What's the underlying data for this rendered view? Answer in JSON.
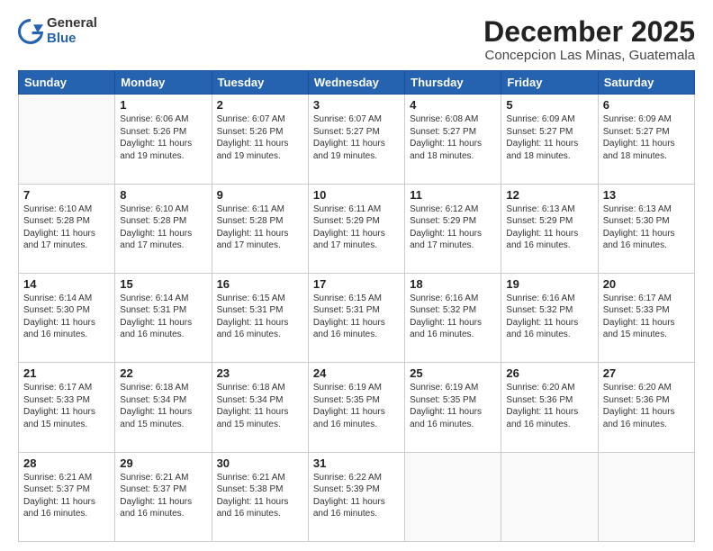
{
  "header": {
    "logo_line1": "General",
    "logo_line2": "Blue",
    "month": "December 2025",
    "location": "Concepcion Las Minas, Guatemala"
  },
  "weekdays": [
    "Sunday",
    "Monday",
    "Tuesday",
    "Wednesday",
    "Thursday",
    "Friday",
    "Saturday"
  ],
  "weeks": [
    [
      {
        "day": "",
        "info": ""
      },
      {
        "day": "1",
        "info": "Sunrise: 6:06 AM\nSunset: 5:26 PM\nDaylight: 11 hours\nand 19 minutes."
      },
      {
        "day": "2",
        "info": "Sunrise: 6:07 AM\nSunset: 5:26 PM\nDaylight: 11 hours\nand 19 minutes."
      },
      {
        "day": "3",
        "info": "Sunrise: 6:07 AM\nSunset: 5:27 PM\nDaylight: 11 hours\nand 19 minutes."
      },
      {
        "day": "4",
        "info": "Sunrise: 6:08 AM\nSunset: 5:27 PM\nDaylight: 11 hours\nand 18 minutes."
      },
      {
        "day": "5",
        "info": "Sunrise: 6:09 AM\nSunset: 5:27 PM\nDaylight: 11 hours\nand 18 minutes."
      },
      {
        "day": "6",
        "info": "Sunrise: 6:09 AM\nSunset: 5:27 PM\nDaylight: 11 hours\nand 18 minutes."
      }
    ],
    [
      {
        "day": "7",
        "info": "Sunrise: 6:10 AM\nSunset: 5:28 PM\nDaylight: 11 hours\nand 17 minutes."
      },
      {
        "day": "8",
        "info": "Sunrise: 6:10 AM\nSunset: 5:28 PM\nDaylight: 11 hours\nand 17 minutes."
      },
      {
        "day": "9",
        "info": "Sunrise: 6:11 AM\nSunset: 5:28 PM\nDaylight: 11 hours\nand 17 minutes."
      },
      {
        "day": "10",
        "info": "Sunrise: 6:11 AM\nSunset: 5:29 PM\nDaylight: 11 hours\nand 17 minutes."
      },
      {
        "day": "11",
        "info": "Sunrise: 6:12 AM\nSunset: 5:29 PM\nDaylight: 11 hours\nand 17 minutes."
      },
      {
        "day": "12",
        "info": "Sunrise: 6:13 AM\nSunset: 5:29 PM\nDaylight: 11 hours\nand 16 minutes."
      },
      {
        "day": "13",
        "info": "Sunrise: 6:13 AM\nSunset: 5:30 PM\nDaylight: 11 hours\nand 16 minutes."
      }
    ],
    [
      {
        "day": "14",
        "info": "Sunrise: 6:14 AM\nSunset: 5:30 PM\nDaylight: 11 hours\nand 16 minutes."
      },
      {
        "day": "15",
        "info": "Sunrise: 6:14 AM\nSunset: 5:31 PM\nDaylight: 11 hours\nand 16 minutes."
      },
      {
        "day": "16",
        "info": "Sunrise: 6:15 AM\nSunset: 5:31 PM\nDaylight: 11 hours\nand 16 minutes."
      },
      {
        "day": "17",
        "info": "Sunrise: 6:15 AM\nSunset: 5:31 PM\nDaylight: 11 hours\nand 16 minutes."
      },
      {
        "day": "18",
        "info": "Sunrise: 6:16 AM\nSunset: 5:32 PM\nDaylight: 11 hours\nand 16 minutes."
      },
      {
        "day": "19",
        "info": "Sunrise: 6:16 AM\nSunset: 5:32 PM\nDaylight: 11 hours\nand 16 minutes."
      },
      {
        "day": "20",
        "info": "Sunrise: 6:17 AM\nSunset: 5:33 PM\nDaylight: 11 hours\nand 15 minutes."
      }
    ],
    [
      {
        "day": "21",
        "info": "Sunrise: 6:17 AM\nSunset: 5:33 PM\nDaylight: 11 hours\nand 15 minutes."
      },
      {
        "day": "22",
        "info": "Sunrise: 6:18 AM\nSunset: 5:34 PM\nDaylight: 11 hours\nand 15 minutes."
      },
      {
        "day": "23",
        "info": "Sunrise: 6:18 AM\nSunset: 5:34 PM\nDaylight: 11 hours\nand 15 minutes."
      },
      {
        "day": "24",
        "info": "Sunrise: 6:19 AM\nSunset: 5:35 PM\nDaylight: 11 hours\nand 16 minutes."
      },
      {
        "day": "25",
        "info": "Sunrise: 6:19 AM\nSunset: 5:35 PM\nDaylight: 11 hours\nand 16 minutes."
      },
      {
        "day": "26",
        "info": "Sunrise: 6:20 AM\nSunset: 5:36 PM\nDaylight: 11 hours\nand 16 minutes."
      },
      {
        "day": "27",
        "info": "Sunrise: 6:20 AM\nSunset: 5:36 PM\nDaylight: 11 hours\nand 16 minutes."
      }
    ],
    [
      {
        "day": "28",
        "info": "Sunrise: 6:21 AM\nSunset: 5:37 PM\nDaylight: 11 hours\nand 16 minutes."
      },
      {
        "day": "29",
        "info": "Sunrise: 6:21 AM\nSunset: 5:37 PM\nDaylight: 11 hours\nand 16 minutes."
      },
      {
        "day": "30",
        "info": "Sunrise: 6:21 AM\nSunset: 5:38 PM\nDaylight: 11 hours\nand 16 minutes."
      },
      {
        "day": "31",
        "info": "Sunrise: 6:22 AM\nSunset: 5:39 PM\nDaylight: 11 hours\nand 16 minutes."
      },
      {
        "day": "",
        "info": ""
      },
      {
        "day": "",
        "info": ""
      },
      {
        "day": "",
        "info": ""
      }
    ]
  ]
}
